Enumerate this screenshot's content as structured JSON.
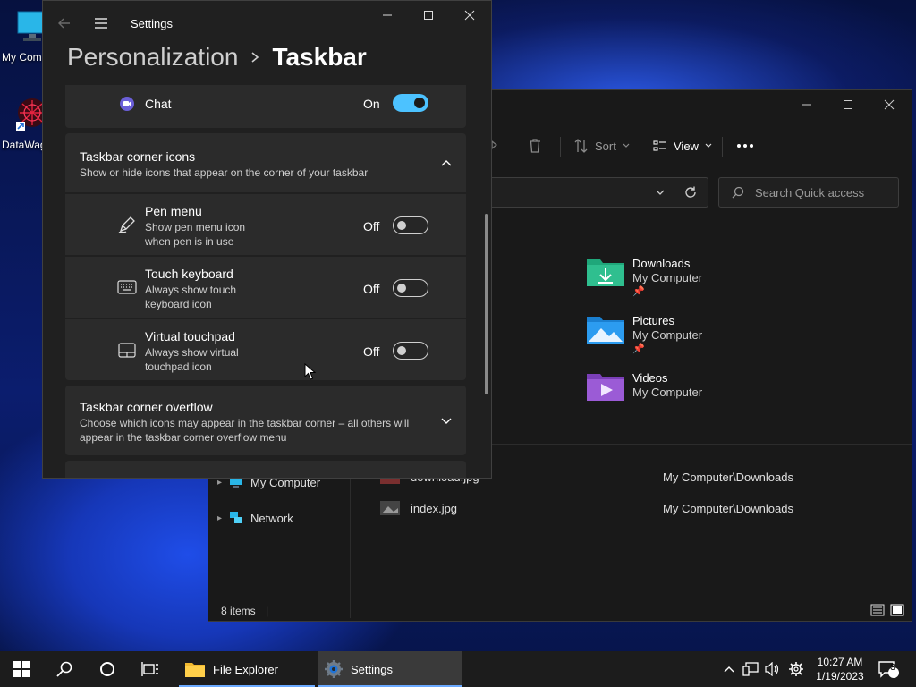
{
  "desktop": {
    "icons": [
      {
        "label": "My Com"
      },
      {
        "label": "DataWag"
      }
    ]
  },
  "explorer": {
    "toolbar": {
      "sort_label": "Sort",
      "view_label": "View"
    },
    "search_placeholder": "Search Quick access",
    "quick_access": [
      {
        "name": "Downloads",
        "location": "My Computer",
        "color": "#2fbf8f"
      },
      {
        "name": "Pictures",
        "location": "My Computer",
        "color": "#2c9cf0"
      },
      {
        "name": "Videos",
        "location": "My Computer",
        "color": "#9b5bd6"
      }
    ],
    "nav": [
      {
        "label": "My Computer"
      },
      {
        "label": "Network"
      }
    ],
    "recent": [
      {
        "name": "download.jpg",
        "path": "My Computer\\Downloads"
      },
      {
        "name": "index.jpg",
        "path": "My Computer\\Downloads"
      }
    ],
    "status_items": "8 items"
  },
  "settings": {
    "app_title": "Settings",
    "breadcrumb": {
      "parent": "Personalization",
      "current": "Taskbar"
    },
    "chat": {
      "label": "Chat",
      "state": "On"
    },
    "corner_icons": {
      "title": "Taskbar corner icons",
      "subtitle": "Show or hide icons that appear on the corner of your taskbar",
      "items": [
        {
          "title": "Pen menu",
          "sub1": "Show pen menu icon",
          "sub2": "when pen is in use",
          "state": "Off"
        },
        {
          "title": "Touch keyboard",
          "sub1": "Always show touch",
          "sub2": "keyboard icon",
          "state": "Off"
        },
        {
          "title": "Virtual touchpad",
          "sub1": "Always show virtual",
          "sub2": "touchpad icon",
          "state": "Off"
        }
      ]
    },
    "overflow": {
      "title": "Taskbar corner overflow",
      "sub1": "Choose which icons may appear in the taskbar corner – all others will",
      "sub2": "appear in the taskbar corner overflow menu"
    }
  },
  "taskbar": {
    "apps": [
      {
        "label": "File Explorer"
      },
      {
        "label": "Settings"
      }
    ],
    "time": "10:27 AM",
    "date": "1/19/2023",
    "notification_count": "3"
  },
  "colors": {
    "accent": "#4cc2ff",
    "taskbar_active_underline": "#6aa9ff"
  }
}
